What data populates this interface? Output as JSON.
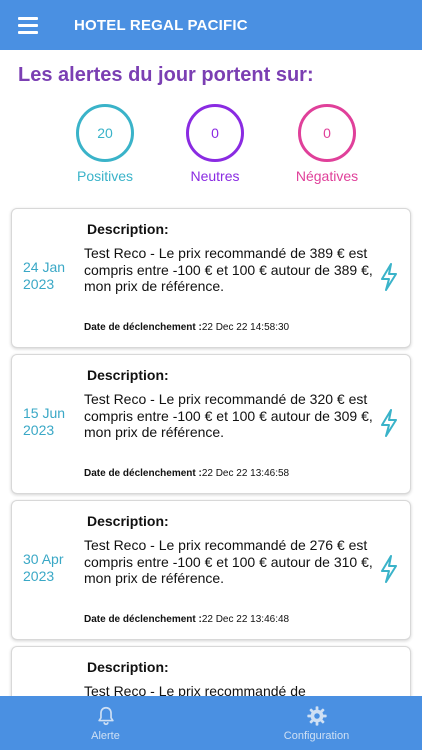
{
  "app": {
    "title": "HOTEL REGAL PACIFIC"
  },
  "headline": "Les alertes du jour portent sur:",
  "stats": [
    {
      "value": "20",
      "label": "Positives",
      "color": "#3ab3c9"
    },
    {
      "value": "0",
      "label": "Neutres",
      "color": "#8a2be2"
    },
    {
      "value": "0",
      "label": "Négatives",
      "color": "#e0409a"
    }
  ],
  "alerts": [
    {
      "desc_title": "Description:",
      "date_line1": "24 Jan",
      "date_line2": "2023",
      "text": "Test Reco  - Le prix recommandé de 389 € est compris entre -100 € et 100 € autour de 389 €, mon prix de référence.",
      "trigger_label": "Date de déclenchement :",
      "trigger_value": "22 Dec 22 14:58:30"
    },
    {
      "desc_title": "Description:",
      "date_line1": "15 Jun",
      "date_line2": "2023",
      "text": "Test Reco  - Le prix recommandé de 320 € est compris entre -100 € et 100 € autour de 309 €, mon prix de référence.",
      "trigger_label": "Date de déclenchement :",
      "trigger_value": "22 Dec 22 13:46:58"
    },
    {
      "desc_title": "Description:",
      "date_line1": "30 Apr",
      "date_line2": "2023",
      "text": "Test Reco  - Le prix recommandé de 276 € est compris entre -100 € et 100 € autour de 310 €, mon prix de référence.",
      "trigger_label": "Date de déclenchement :",
      "trigger_value": "22 Dec 22 13:46:48"
    },
    {
      "desc_title": "Description:",
      "date_line1": "",
      "date_line2": "",
      "text": "Test Reco  - Le prix recommandé de",
      "trigger_label": "",
      "trigger_value": ""
    }
  ],
  "nav": [
    {
      "label": "Alerte",
      "icon": "bell-icon"
    },
    {
      "label": "Configuration",
      "icon": "gear-icon"
    }
  ],
  "colors": {
    "primary": "#4a90e2",
    "headline": "#7b3fb3",
    "date": "#3aa8c6",
    "bolt": "#3ab3c9"
  }
}
